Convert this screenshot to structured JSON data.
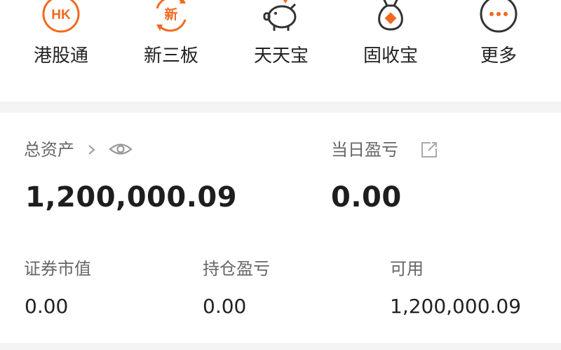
{
  "quick_menu": [
    {
      "label": "港股通",
      "icon": "hk-icon",
      "icon_text": "HK"
    },
    {
      "label": "新三板",
      "icon": "new-board-icon",
      "icon_text": "新"
    },
    {
      "label": "天天宝",
      "icon": "piggy-bank-icon"
    },
    {
      "label": "固收宝",
      "icon": "money-bag-icon"
    },
    {
      "label": "更多",
      "icon": "more-icon"
    }
  ],
  "assets": {
    "total_label": "总资产",
    "total_value": "1,200,000.09",
    "daily_pl_label": "当日盈亏",
    "daily_pl_value": "0.00",
    "market_value_label": "证券市值",
    "market_value": "0.00",
    "position_pl_label": "持仓盈亏",
    "position_pl_value": "0.00",
    "available_label": "可用",
    "available_value": "1,200,000.09"
  },
  "colors": {
    "accent": "#F2691E",
    "icon_gray": "#9a9a9a",
    "background_band": "#f4f4f6"
  }
}
